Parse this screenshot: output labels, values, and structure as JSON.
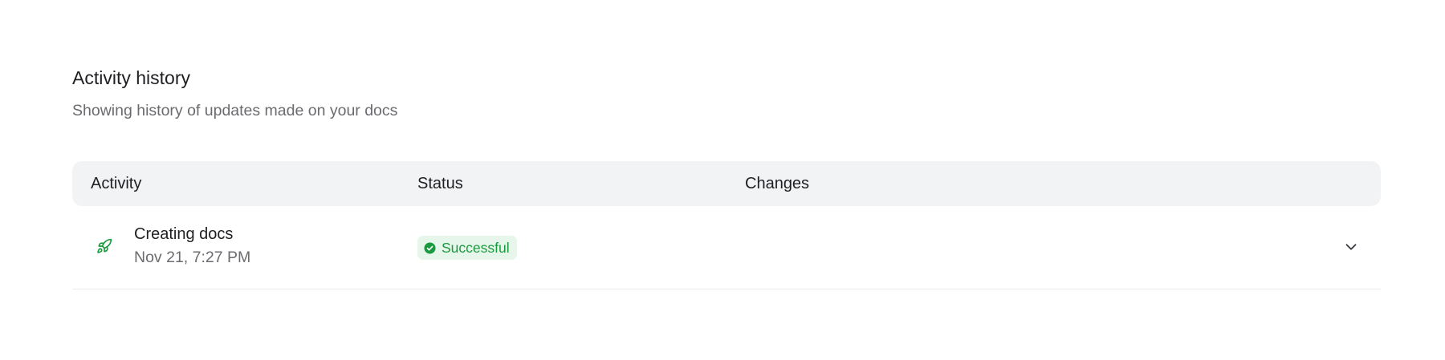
{
  "section": {
    "title": "Activity history",
    "subtitle": "Showing history of updates made on your docs"
  },
  "table": {
    "columns": [
      "Activity",
      "Status",
      "Changes"
    ],
    "rows": [
      {
        "icon": "rocket-icon",
        "title": "Creating docs",
        "timestamp": "Nov 21, 7:27 PM",
        "status": "Successful",
        "status_icon": "check-circle-icon",
        "changes": "",
        "expand_icon": "chevron-down-icon"
      }
    ]
  },
  "colors": {
    "success_text": "#1a9a3f",
    "success_bg": "#e7f6ea",
    "header_bg": "#f2f3f5"
  }
}
